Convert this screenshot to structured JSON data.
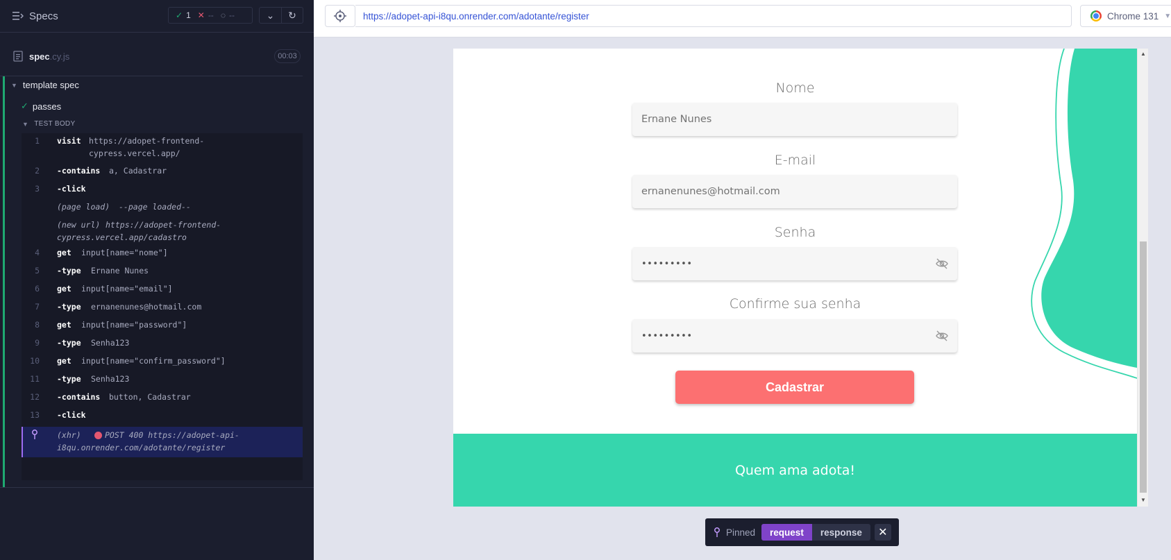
{
  "reporter": {
    "header": {
      "title": "Specs",
      "passed_count": "1",
      "failed_count": "--",
      "pending_count": "--"
    },
    "spec_file": {
      "name": "spec",
      "extension": ".cy.js",
      "duration": "00:03"
    },
    "suite": {
      "title": "template spec",
      "test_title": "passes",
      "body_label": "TEST BODY"
    },
    "commands": [
      {
        "num": "1",
        "name": "visit",
        "message": "https://adopet-frontend-\ncypress.vercel.app/"
      },
      {
        "num": "2",
        "name": "-contains",
        "message": "a, Cadastrar"
      },
      {
        "num": "3",
        "name": "-click",
        "message": ""
      },
      {
        "num": "",
        "name": "(page load)",
        "message": "--page loaded--"
      },
      {
        "num": "",
        "name": "(new url)",
        "message": "https://adopet-frontend-\ncypress.vercel.app/cadastro"
      },
      {
        "num": "4",
        "name": "get",
        "message": "input[name=\"nome\"]"
      },
      {
        "num": "5",
        "name": "-type",
        "message": "Ernane Nunes"
      },
      {
        "num": "6",
        "name": "get",
        "message": "input[name=\"email\"]"
      },
      {
        "num": "7",
        "name": "-type",
        "message": "ernanenunes@hotmail.com"
      },
      {
        "num": "8",
        "name": "get",
        "message": "input[name=\"password\"]"
      },
      {
        "num": "9",
        "name": "-type",
        "message": "Senha123"
      },
      {
        "num": "10",
        "name": "get",
        "message": "input[name=\"confirm_password\"]"
      },
      {
        "num": "11",
        "name": "-type",
        "message": "Senha123"
      },
      {
        "num": "12",
        "name": "-contains",
        "message": "button, Cadastrar"
      },
      {
        "num": "13",
        "name": "-click",
        "message": ""
      },
      {
        "num": "",
        "name": "(xhr)",
        "message": "POST 400 https://adopet-api-\ni8qu.onrender.com/adotante/register"
      }
    ]
  },
  "topbar": {
    "url": "https://adopet-api-i8qu.onrender.com/adotante/register",
    "browser": "Chrome 131"
  },
  "form": {
    "name_label": "Nome",
    "name_value": "Ernane Nunes",
    "email_label": "E-mail",
    "email_value": "ernanenunes@hotmail.com",
    "password_label": "Senha",
    "password_value": "•••••••••",
    "confirm_label": "Confirme sua senha",
    "confirm_value": "•••••••••",
    "submit_label": "Cadastrar",
    "footer_text": "Quem ama adota!"
  },
  "pinned": {
    "label": "Pinned",
    "request_label": "request",
    "response_label": "response"
  },
  "colors": {
    "accent_green": "#36d6ad",
    "button_coral": "#fc7071",
    "reporter_bg": "#1b1e2e",
    "pass_green": "#1fa971",
    "xhr_highlight": "#1c2258"
  }
}
